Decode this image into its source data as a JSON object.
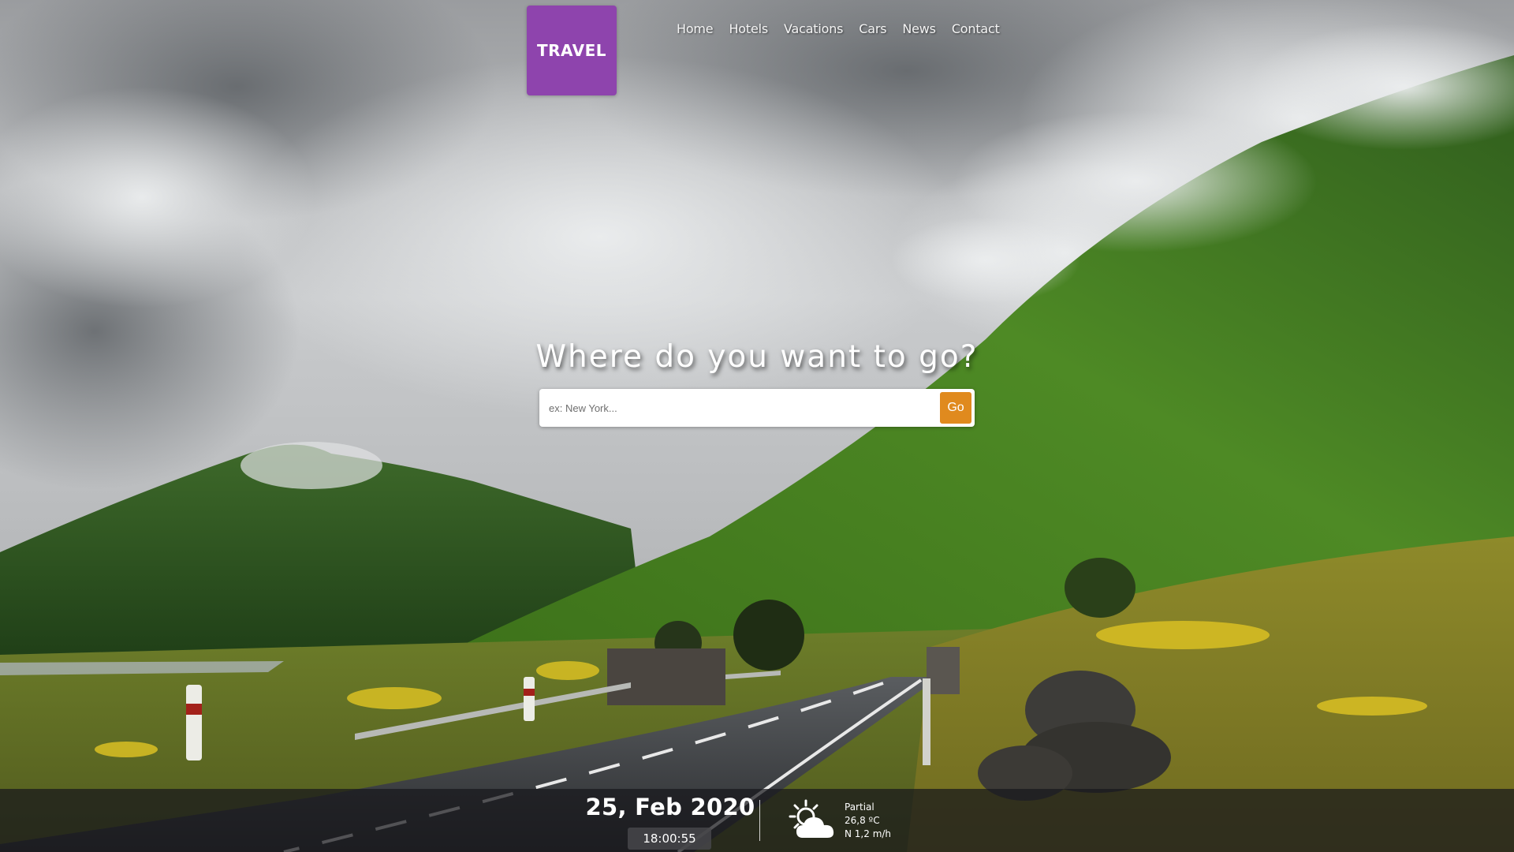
{
  "header": {
    "logo_text": "TRAVEL",
    "nav": [
      {
        "label": "Home"
      },
      {
        "label": "Hotels"
      },
      {
        "label": "Vacations"
      },
      {
        "label": "Cars"
      },
      {
        "label": "News"
      },
      {
        "label": "Contact"
      }
    ]
  },
  "hero": {
    "title": "Where do you want to go?"
  },
  "search": {
    "placeholder": "ex: New York...",
    "value": "",
    "button_label": "Go"
  },
  "info_bar": {
    "date": "25, Feb 2020",
    "time": "18:00:55",
    "weather": {
      "icon": "partly-cloudy-icon",
      "condition": "Partial",
      "temperature": "26,8 ºC",
      "wind": "N 1,2 m/h"
    }
  },
  "colors": {
    "brand": "#8e44ad",
    "accent": "#e08a1e",
    "info_bar": "#18181c"
  }
}
